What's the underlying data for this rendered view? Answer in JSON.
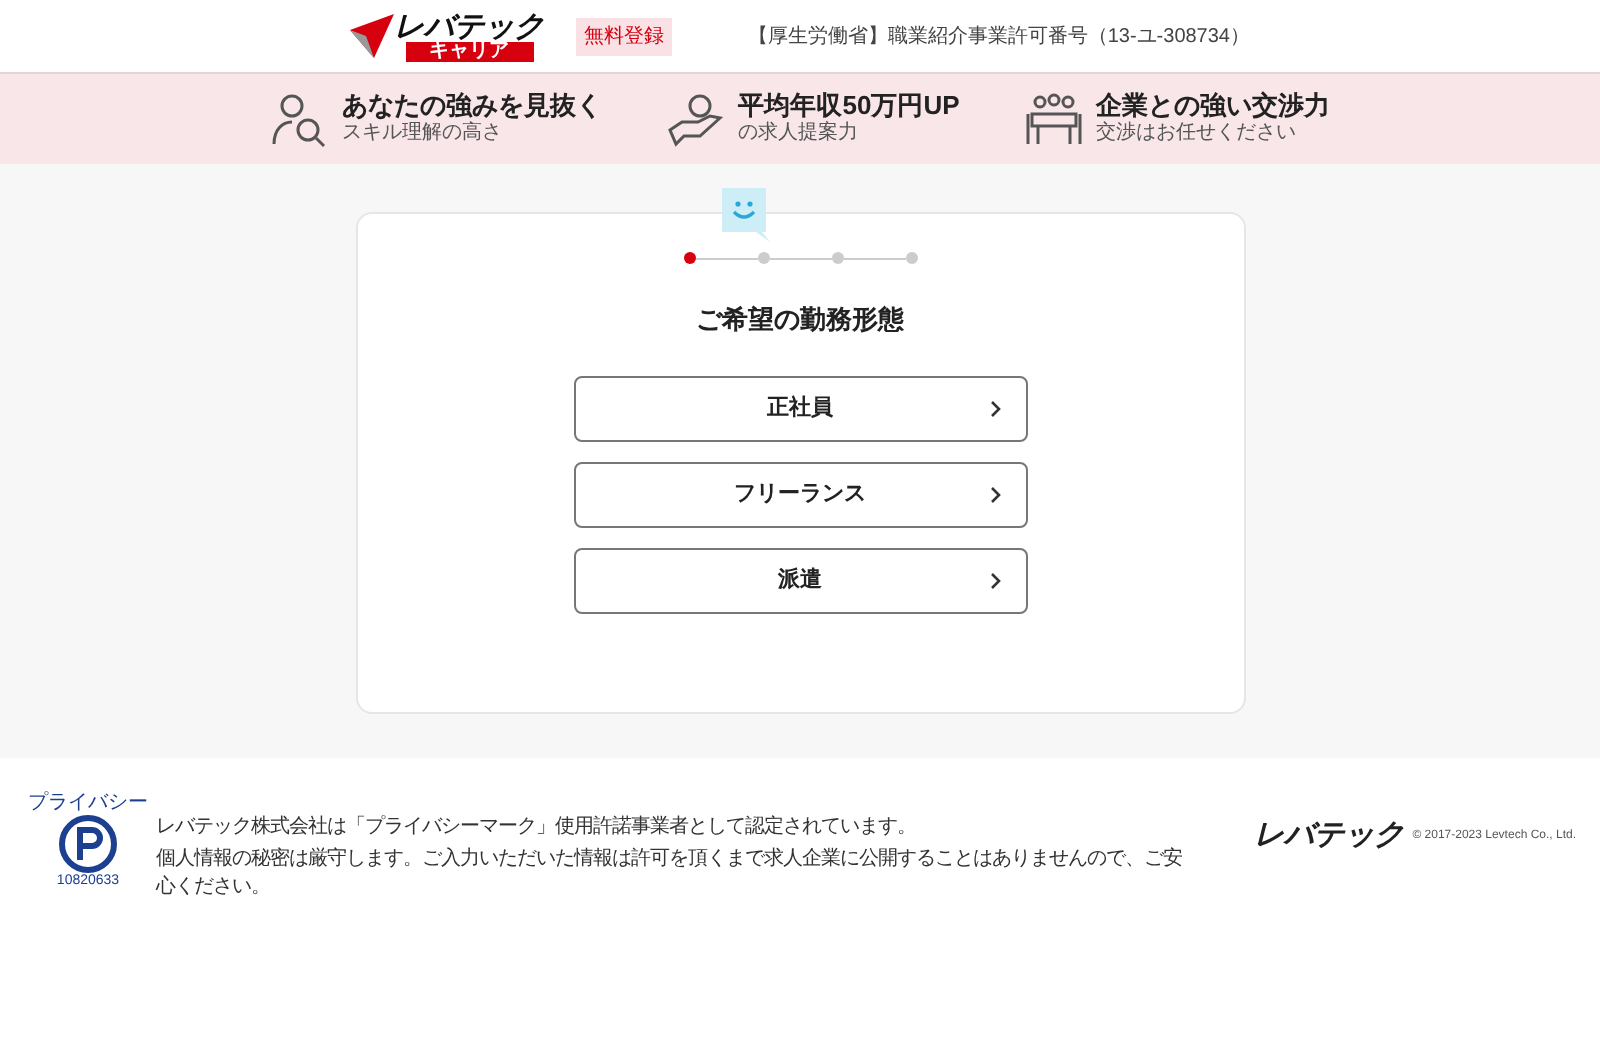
{
  "header": {
    "logo": {
      "name": "レバテック",
      "sub": "キャリア"
    },
    "badge": "無料登録",
    "license": "【厚生労働省】職業紹介事業許可番号（13-ユ-308734）"
  },
  "features": [
    {
      "kind": "person",
      "title": "あなたの強みを見抜く",
      "subtitle": "スキル理解の高さ"
    },
    {
      "kind": "money",
      "title": "平均年収50万円UP",
      "subtitle": "の求人提案力"
    },
    {
      "kind": "meeting",
      "title": "企業との強い交渉力",
      "subtitle": "交渉はお任せください"
    }
  ],
  "steps": [
    {
      "selected": true
    },
    {
      "selected": false
    },
    {
      "selected": false
    },
    {
      "selected": false
    }
  ],
  "question": "ご希望の勤務形態",
  "options": [
    {
      "label": "正社員"
    },
    {
      "label": "フリーランス"
    },
    {
      "label": "派遣"
    }
  ],
  "footer": {
    "mark_label": "プライバシー",
    "mark_number": "10820633",
    "lines": [
      "レバテック株式会社は「プライバシーマーク」使用許諾事業者として認定されています。",
      "個人情報の秘密は厳守します。ご入力いただいた情報は許可を頂くまで求人企業に公開することはありませんので、ご安心ください。"
    ],
    "logo": "レバテック",
    "copyright": "© 2017-2023 Levtech Co., Ltd."
  }
}
